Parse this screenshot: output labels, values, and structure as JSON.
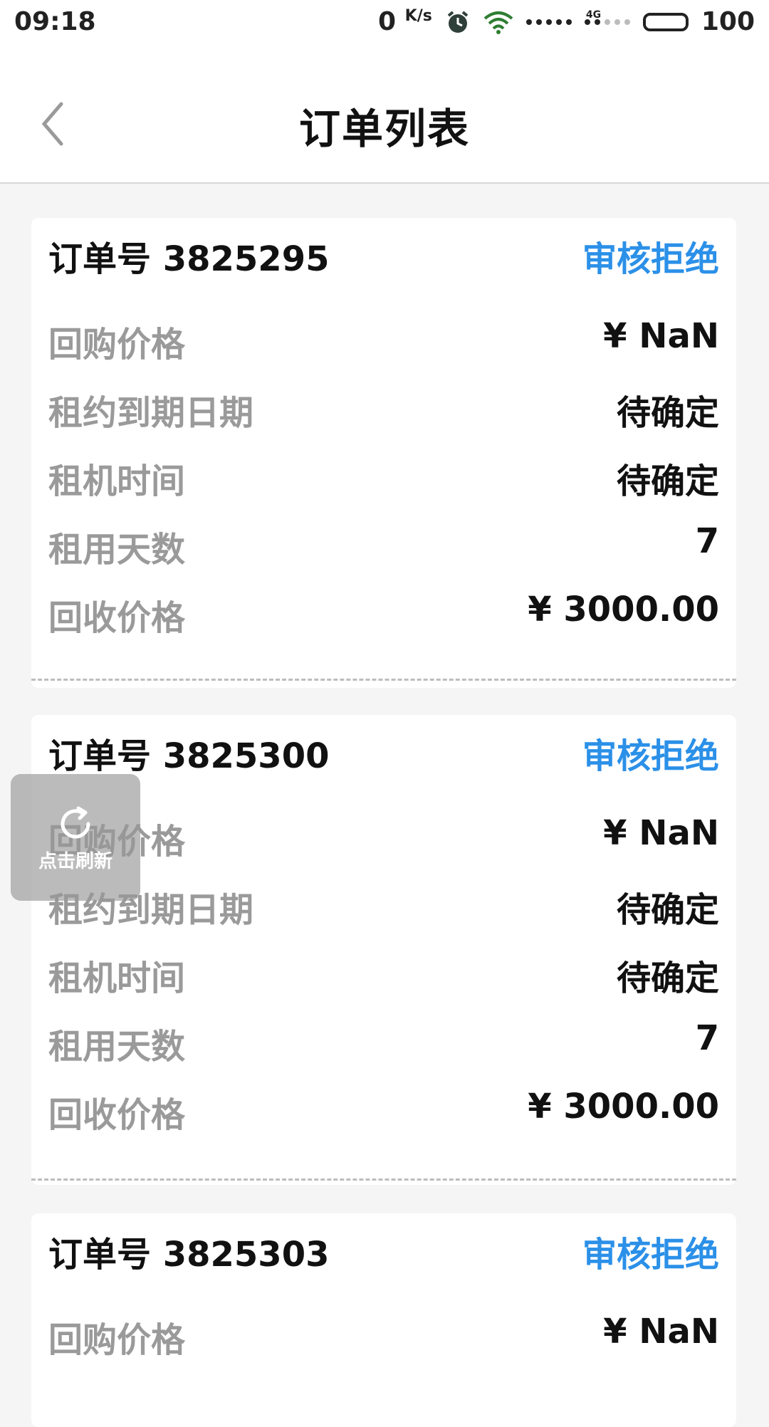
{
  "status_bar": {
    "time": "09:18",
    "net_speed": "0",
    "net_unit": "K/s",
    "net_type": "4G",
    "battery": "100"
  },
  "header": {
    "title": "订单列表"
  },
  "orders": [
    {
      "order_no": "订单号 3825295",
      "status": "审核拒绝",
      "rows": [
        {
          "label": "回购价格",
          "value": "¥ NaN"
        },
        {
          "label": "租约到期日期",
          "value": "待确定"
        },
        {
          "label": "租机时间",
          "value": "待确定"
        },
        {
          "label": "租用天数",
          "value": "7"
        },
        {
          "label": "回收价格",
          "value": "¥ 3000.00"
        }
      ]
    },
    {
      "order_no": "订单号 3825300",
      "status": "审核拒绝",
      "rows": [
        {
          "label": "回购价格",
          "value": "¥ NaN"
        },
        {
          "label": "租约到期日期",
          "value": "待确定"
        },
        {
          "label": "租机时间",
          "value": "待确定"
        },
        {
          "label": "租用天数",
          "value": "7"
        },
        {
          "label": "回收价格",
          "value": "¥ 3000.00"
        }
      ]
    },
    {
      "order_no": "订单号 3825303",
      "status": "审核拒绝",
      "rows": [
        {
          "label": "回购价格",
          "value": "¥ NaN"
        }
      ]
    }
  ],
  "refresh_button": {
    "label": "点击刷新"
  },
  "colors": {
    "status_blue": "#2b90e8",
    "label_gray": "#9a9a9a",
    "background": "#f5f5f5"
  },
  "icons": [
    "back-arrow-icon",
    "alarm-icon",
    "wifi-icon",
    "signal-icon",
    "battery-icon",
    "refresh-icon"
  ]
}
